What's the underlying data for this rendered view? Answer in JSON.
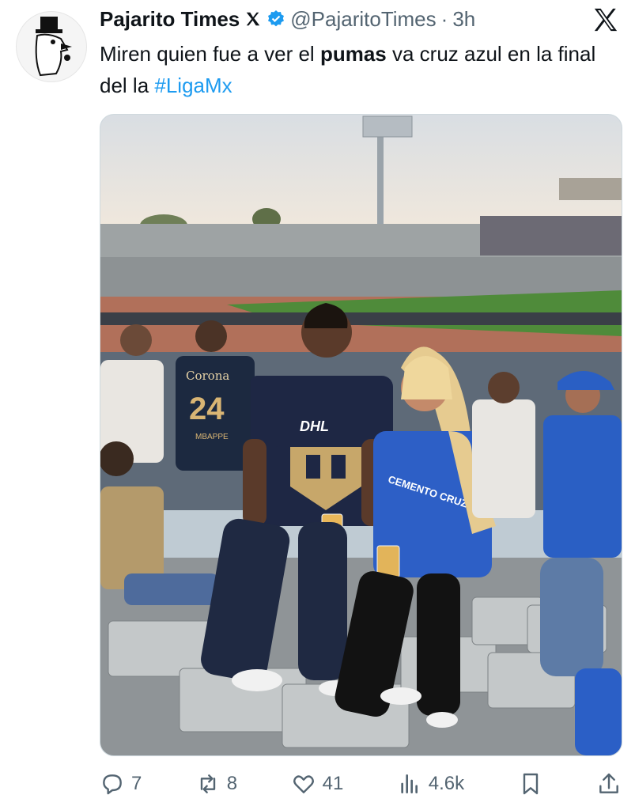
{
  "tweet": {
    "display_name": "Pajarito Times",
    "handle": "@PajaritoTimes",
    "separator": "·",
    "time": "3h",
    "text_part1": "Miren quien fue a ver el ",
    "text_bold": "pumas",
    "text_part2": " va cruz azul en la final del la ",
    "hashtag": "#LigaMx",
    "badges": [
      "x-badge-icon",
      "verified-icon"
    ],
    "platform_logo": "x-logo-icon"
  },
  "media": {
    "jerseys": {
      "back_number": "24",
      "back_sponsor": "Corona",
      "back_name": "MBAPPE",
      "front_sponsor": "DHL",
      "cruz_azul_sponsor": "CEMENTO CRUZ AZUL"
    }
  },
  "actions": {
    "replies": "7",
    "reposts": "8",
    "likes": "41",
    "views": "4.6k"
  },
  "colors": {
    "link": "#1d9bf0",
    "muted": "#536471",
    "text": "#0f1419"
  }
}
